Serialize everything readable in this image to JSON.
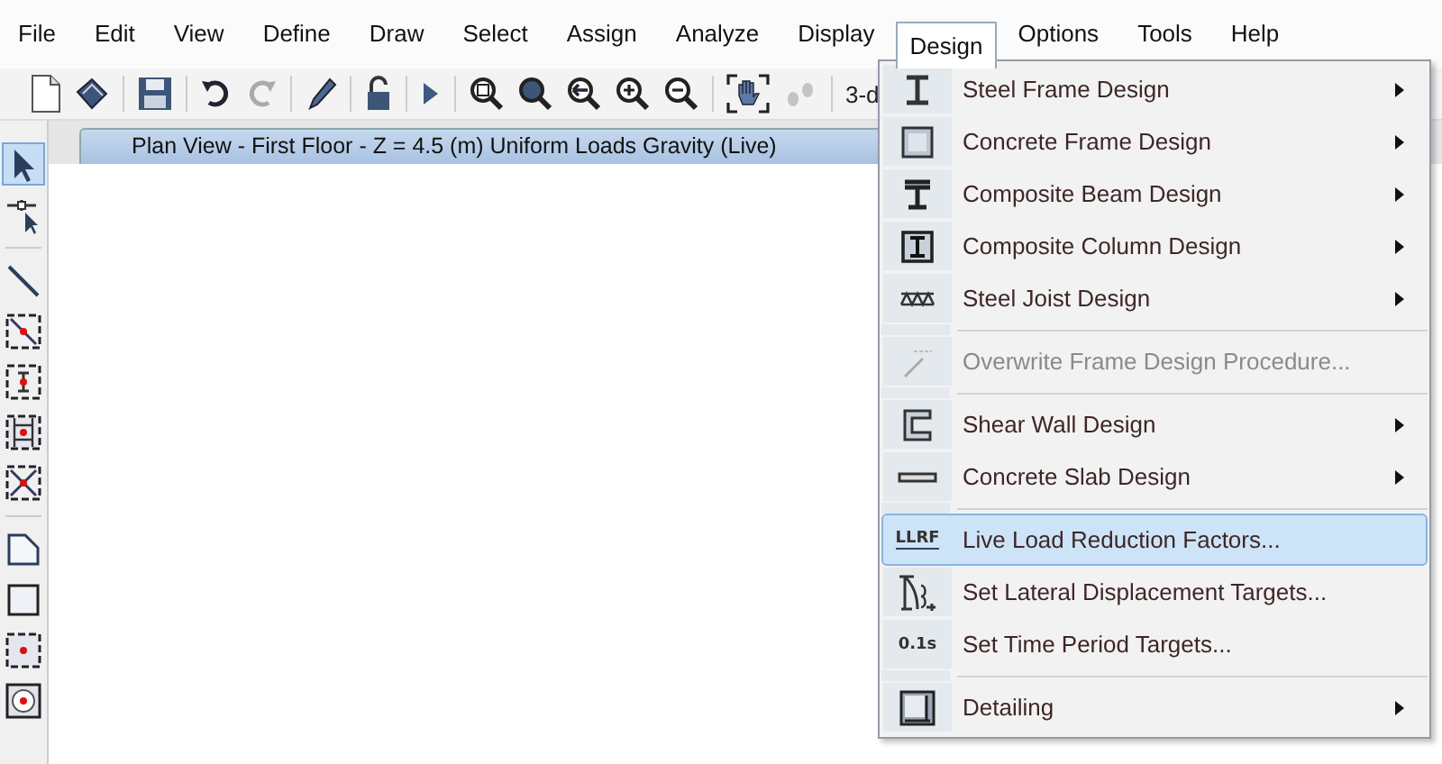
{
  "menu_bar": [
    {
      "label": "File",
      "selected": false
    },
    {
      "label": "Edit",
      "selected": false
    },
    {
      "label": "View",
      "selected": false
    },
    {
      "label": "Define",
      "selected": false
    },
    {
      "label": "Draw",
      "selected": false
    },
    {
      "label": "Select",
      "selected": false
    },
    {
      "label": "Assign",
      "selected": false
    },
    {
      "label": "Analyze",
      "selected": false
    },
    {
      "label": "Display",
      "selected": false
    },
    {
      "label": "Design",
      "selected": true
    },
    {
      "label": "Options",
      "selected": false
    },
    {
      "label": "Tools",
      "selected": false
    },
    {
      "label": "Help",
      "selected": false
    }
  ],
  "toolbar": {
    "cut_label": "3-d"
  },
  "left_toolbar": [
    {
      "selected": true
    },
    {
      "selected": false
    },
    {
      "selected": false
    },
    {
      "selected": false
    },
    {
      "selected": false
    },
    {
      "selected": false
    },
    {
      "selected": false
    },
    {
      "selected": false
    },
    {
      "selected": false
    },
    {
      "selected": false
    },
    {
      "selected": false
    }
  ],
  "view_tab": {
    "title": "Plan View - First Floor - Z = 4.5 (m)  Uniform Loads Gravity  (Live)"
  },
  "design_menu": [
    {
      "kind": "item",
      "label": "Steel Frame Design",
      "submenu": true,
      "disabled": false,
      "selected": false
    },
    {
      "kind": "item",
      "label": "Concrete Frame Design",
      "submenu": true,
      "disabled": false,
      "selected": false
    },
    {
      "kind": "item",
      "label": "Composite Beam Design",
      "submenu": true,
      "disabled": false,
      "selected": false
    },
    {
      "kind": "item",
      "label": "Composite Column Design",
      "submenu": true,
      "disabled": false,
      "selected": false
    },
    {
      "kind": "item",
      "label": "Steel Joist Design",
      "submenu": true,
      "disabled": false,
      "selected": false
    },
    {
      "kind": "separator"
    },
    {
      "kind": "item",
      "label": "Overwrite Frame Design Procedure...",
      "submenu": false,
      "disabled": true,
      "selected": false
    },
    {
      "kind": "separator"
    },
    {
      "kind": "item",
      "label": "Shear Wall Design",
      "submenu": true,
      "disabled": false,
      "selected": false
    },
    {
      "kind": "item",
      "label": "Concrete Slab Design",
      "submenu": true,
      "disabled": false,
      "selected": false
    },
    {
      "kind": "separator"
    },
    {
      "kind": "item",
      "label": "Live Load Reduction Factors...",
      "submenu": false,
      "disabled": false,
      "selected": true,
      "icon_text": "LLRF"
    },
    {
      "kind": "item",
      "label": "Set Lateral Displacement Targets...",
      "submenu": false,
      "disabled": false,
      "selected": false
    },
    {
      "kind": "item",
      "label": "Set Time Period Targets...",
      "submenu": false,
      "disabled": false,
      "selected": false,
      "icon_text": "0.1s"
    },
    {
      "kind": "separator"
    },
    {
      "kind": "item",
      "label": "Detailing",
      "submenu": true,
      "disabled": false,
      "selected": false
    }
  ]
}
